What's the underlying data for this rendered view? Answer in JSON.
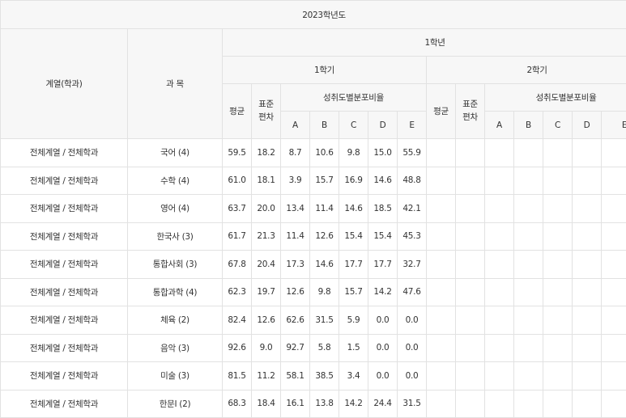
{
  "header": {
    "year": "2023학년도",
    "department_col": "계열(학과)",
    "subject_col": "과 목",
    "grade": "1학년",
    "semester1": "1학기",
    "semester2": "2학기",
    "avg": "평균",
    "std": "표준\n편차",
    "dist": "성취도별분포비율",
    "grades": [
      "A",
      "B",
      "C",
      "D",
      "E"
    ]
  },
  "rows": [
    {
      "dept": "전체계열 / 전체학과",
      "subject": "국어 (4)",
      "avg": "59.5",
      "std": "18.2",
      "a": "8.7",
      "b": "10.6",
      "c": "9.8",
      "d": "15.0",
      "e": "55.9"
    },
    {
      "dept": "전체계열 / 전체학과",
      "subject": "수학 (4)",
      "avg": "61.0",
      "std": "18.1",
      "a": "3.9",
      "b": "15.7",
      "c": "16.9",
      "d": "14.6",
      "e": "48.8"
    },
    {
      "dept": "전체계열 / 전체학과",
      "subject": "영어 (4)",
      "avg": "63.7",
      "std": "20.0",
      "a": "13.4",
      "b": "11.4",
      "c": "14.6",
      "d": "18.5",
      "e": "42.1"
    },
    {
      "dept": "전체계열 / 전체학과",
      "subject": "한국사 (3)",
      "avg": "61.7",
      "std": "21.3",
      "a": "11.4",
      "b": "12.6",
      "c": "15.4",
      "d": "15.4",
      "e": "45.3"
    },
    {
      "dept": "전체계열 / 전체학과",
      "subject": "통합사회 (3)",
      "avg": "67.8",
      "std": "20.4",
      "a": "17.3",
      "b": "14.6",
      "c": "17.7",
      "d": "17.7",
      "e": "32.7"
    },
    {
      "dept": "전체계열 / 전체학과",
      "subject": "통합과학 (4)",
      "avg": "62.3",
      "std": "19.7",
      "a": "12.6",
      "b": "9.8",
      "c": "15.7",
      "d": "14.2",
      "e": "47.6"
    },
    {
      "dept": "전체계열 / 전체학과",
      "subject": "체육 (2)",
      "avg": "82.4",
      "std": "12.6",
      "a": "62.6",
      "b": "31.5",
      "c": "5.9",
      "d": "0.0",
      "e": "0.0"
    },
    {
      "dept": "전체계열 / 전체학과",
      "subject": "음악 (3)",
      "avg": "92.6",
      "std": "9.0",
      "a": "92.7",
      "b": "5.8",
      "c": "1.5",
      "d": "0.0",
      "e": "0.0"
    },
    {
      "dept": "전체계열 / 전체학과",
      "subject": "미술 (3)",
      "avg": "81.5",
      "std": "11.2",
      "a": "58.1",
      "b": "38.5",
      "c": "3.4",
      "d": "0.0",
      "e": "0.0"
    },
    {
      "dept": "전체계열 / 전체학과",
      "subject": "한문Ⅰ (2)",
      "avg": "68.3",
      "std": "18.4",
      "a": "16.1",
      "b": "13.8",
      "c": "14.2",
      "d": "24.4",
      "e": "31.5"
    }
  ]
}
